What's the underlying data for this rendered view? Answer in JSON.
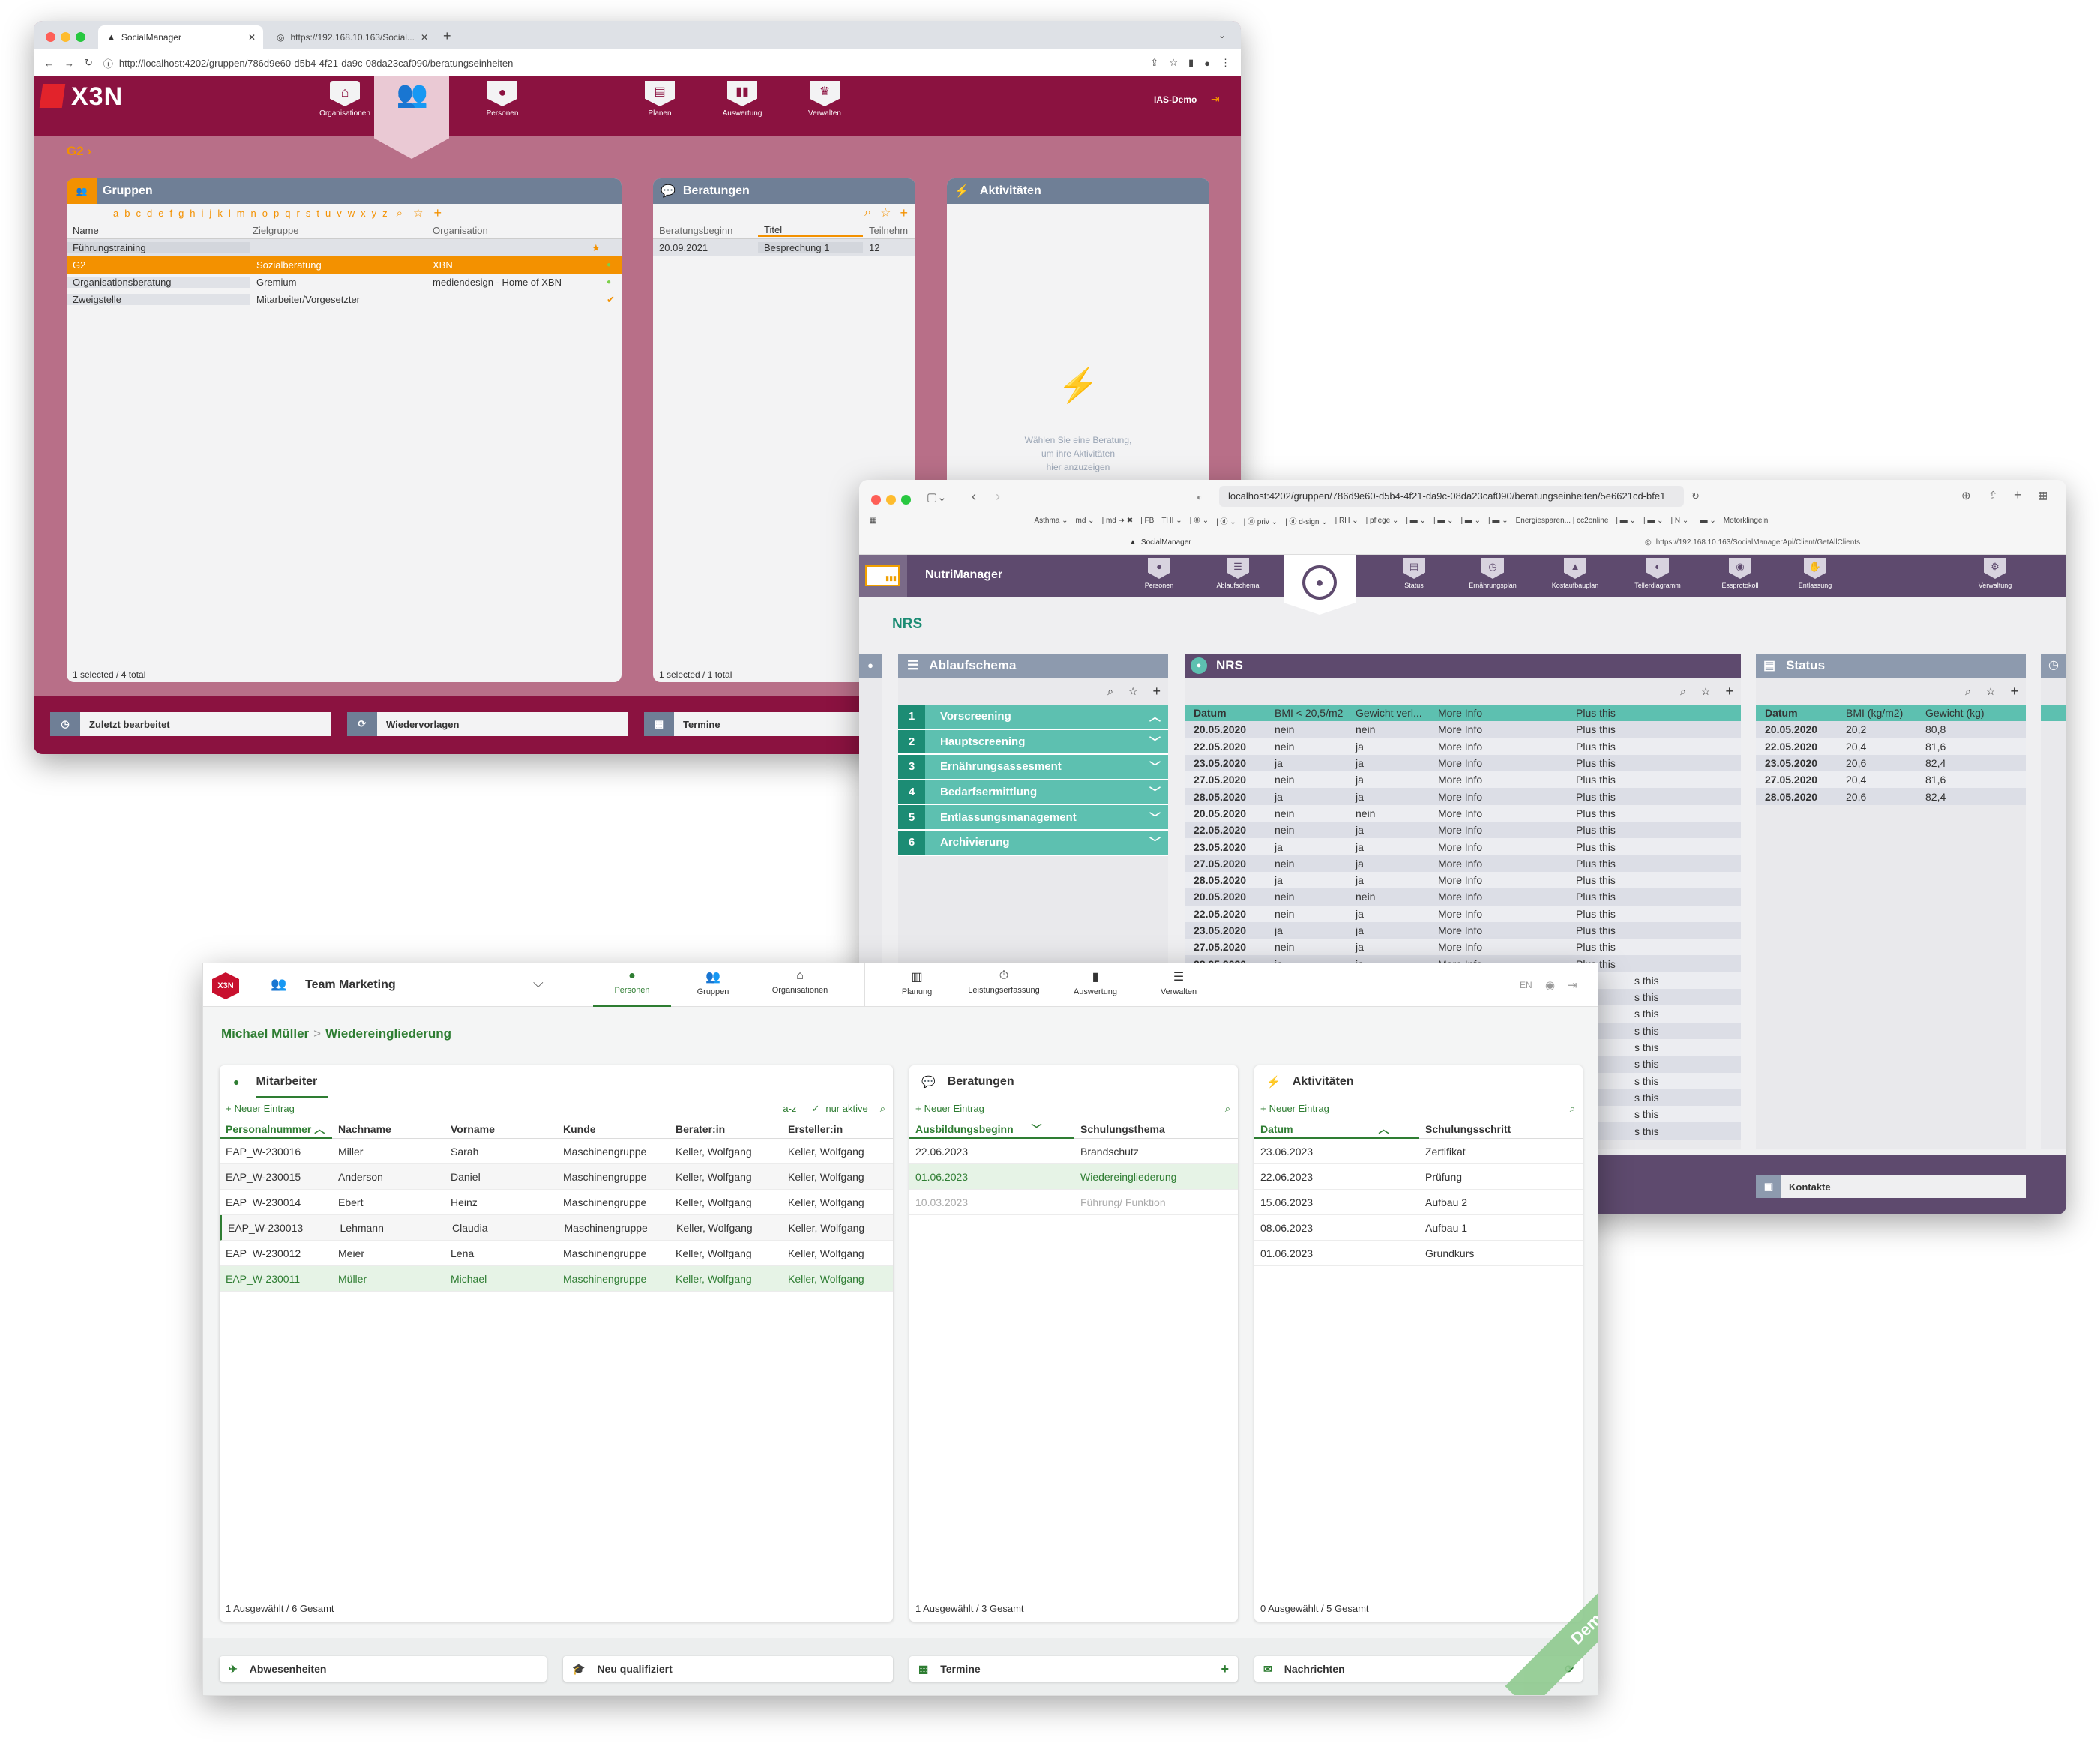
{
  "w1": {
    "tab1": "SocialManager",
    "tab2": "https://192.168.10.163/Social...",
    "url": "http://localhost:4202/gruppen/786d9e60-d5b4-4f21-da9c-08da23caf090/beratungseinheiten",
    "logo": "X3N",
    "nav": [
      "Organisationen",
      "Gruppen",
      "Personen",
      "Planen",
      "Auswertung",
      "Verwalten"
    ],
    "user": "IAS-Demo",
    "breadcrumb": "G2 ›",
    "gruppen": {
      "title": "Gruppen",
      "alphabet": [
        "a",
        "b",
        "c",
        "d",
        "e",
        "f",
        "g",
        "h",
        "i",
        "j",
        "k",
        "l",
        "m",
        "n",
        "o",
        "p",
        "q",
        "r",
        "s",
        "t",
        "u",
        "v",
        "w",
        "x",
        "y",
        "z"
      ],
      "columns": [
        "Name",
        "Zielgruppe",
        "Organisation"
      ],
      "rows": [
        {
          "name": "Führungstraining",
          "ziel": "",
          "org": ""
        },
        {
          "name": "G2",
          "ziel": "Sozialberatung",
          "org": "XBN"
        },
        {
          "name": "Organisationsberatung",
          "ziel": "Gremium",
          "org": "mediendesign - Home of XBN"
        },
        {
          "name": "Zweigstelle",
          "ziel": "Mitarbeiter/Vorgesetzter",
          "org": ""
        }
      ],
      "footer": "1 selected / 4 total"
    },
    "beratungen": {
      "title": "Beratungen",
      "columns": [
        "Beratungsbeginn",
        "Titel",
        "Teilnehm"
      ],
      "rows": [
        {
          "beginn": "20.09.2021",
          "titel": "Besprechung 1",
          "teil": "12"
        }
      ],
      "footer": "1 selected / 1 total"
    },
    "aktivitaeten": {
      "title": "Aktivitäten",
      "empty": [
        "Wählen Sie eine Beratung,",
        "um ihre Aktivitäten",
        "hier anzuzeigen"
      ]
    },
    "bottom": [
      "Zuletzt bearbeitet",
      "Wiedervorlagen",
      "Termine"
    ]
  },
  "w2": {
    "url": "localhost:4202/gruppen/786d9e60-d5b4-4f21-da9c-08da23caf090/beratungseinheiten/5e6621cd-bfe1",
    "bookmarks": [
      "Asthma ⌄",
      "md ⌄",
      "| md ➔ ✖",
      "| FB",
      "THI ⌄",
      "| ⑧ ⌄",
      "| ⓓ ⌄",
      "| ⓓ priv ⌄",
      "| ⓓ d-sign ⌄",
      "| RH ⌄",
      "| pflege ⌄",
      "| ▬ ⌄",
      "| ▬ ⌄",
      "| ▬ ⌄",
      "| ▬ ⌄",
      "Energiesparen... | cc2online",
      "| ▬ ⌄",
      "| ▬ ⌄",
      "| N ⌄",
      "| ▬ ⌄",
      "Motorklingeln"
    ],
    "tab1": "SocialManager",
    "tab2": "https://192.168.10.163/SocialManagerApi/Client/GetAllClients",
    "appname": "NutriManager",
    "nav": [
      "Personen",
      "Ablaufschema",
      "",
      "Status",
      "Ernährungsplan",
      "Kostaufbauplan",
      "Tellerdiagramm",
      "Essprotokoll",
      "Entlassung",
      "Verwaltung"
    ],
    "page_title": "NRS",
    "ablauf": {
      "title": "Ablaufschema",
      "steps": [
        {
          "n": "1",
          "label": "Vorscreening"
        },
        {
          "n": "2",
          "label": "Hauptscreening"
        },
        {
          "n": "3",
          "label": "Ernährungsassesment"
        },
        {
          "n": "4",
          "label": "Bedarfsermittlung"
        },
        {
          "n": "5",
          "label": "Entlassungsmanagement"
        },
        {
          "n": "6",
          "label": "Archivierung"
        }
      ]
    },
    "nrs": {
      "title": "NRS",
      "columns": [
        "Datum",
        "BMI < 20,5/m2",
        "Gewicht verl...",
        "More Info",
        "Plus this"
      ],
      "rows": [
        [
          "20.05.2020",
          "nein",
          "nein",
          "More Info",
          "Plus this"
        ],
        [
          "22.05.2020",
          "nein",
          "ja",
          "More Info",
          "Plus this"
        ],
        [
          "23.05.2020",
          "ja",
          "ja",
          "More Info",
          "Plus this"
        ],
        [
          "27.05.2020",
          "nein",
          "ja",
          "More Info",
          "Plus this"
        ],
        [
          "28.05.2020",
          "ja",
          "ja",
          "More Info",
          "Plus this"
        ],
        [
          "20.05.2020",
          "nein",
          "nein",
          "More Info",
          "Plus this"
        ],
        [
          "22.05.2020",
          "nein",
          "ja",
          "More Info",
          "Plus this"
        ],
        [
          "23.05.2020",
          "ja",
          "ja",
          "More Info",
          "Plus this"
        ],
        [
          "27.05.2020",
          "nein",
          "ja",
          "More Info",
          "Plus this"
        ],
        [
          "28.05.2020",
          "ja",
          "ja",
          "More Info",
          "Plus this"
        ],
        [
          "20.05.2020",
          "nein",
          "nein",
          "More Info",
          "Plus this"
        ],
        [
          "22.05.2020",
          "nein",
          "ja",
          "More Info",
          "Plus this"
        ],
        [
          "23.05.2020",
          "ja",
          "ja",
          "More Info",
          "Plus this"
        ],
        [
          "27.05.2020",
          "nein",
          "ja",
          "More Info",
          "Plus this"
        ],
        [
          "28.05.2020",
          "ja",
          "ja",
          "More Info",
          "Plus this"
        ]
      ],
      "tail": [
        "s this",
        "s this",
        "s this",
        "s this",
        "s this",
        "s this",
        "s this",
        "s this",
        "s this",
        "s this"
      ]
    },
    "status": {
      "title": "Status",
      "columns": [
        "Datum",
        "BMI (kg/m2)",
        "Gewicht (kg)"
      ],
      "rows": [
        [
          "20.05.2020",
          "20,2",
          "80,8"
        ],
        [
          "22.05.2020",
          "20,4",
          "81,6"
        ],
        [
          "23.05.2020",
          "20,6",
          "82,4"
        ],
        [
          "27.05.2020",
          "20,4",
          "81,6"
        ],
        [
          "28.05.2020",
          "20,6",
          "82,4"
        ]
      ]
    },
    "bottom": "Kontakte"
  },
  "w3": {
    "logo": "X3N",
    "team": "Team Marketing",
    "nav_left": [
      "Personen",
      "Gruppen",
      "Organisationen"
    ],
    "nav_right": [
      "Planung",
      "Leistungserfassung",
      "Auswertung",
      "Verwalten"
    ],
    "lang": "EN",
    "breadcrumb_name": "Michael Müller",
    "breadcrumb_sep": ">",
    "breadcrumb_page": "Wiedereingliederung",
    "mitarbeiter": {
      "tab": "Mitarbeiter",
      "new": "Neuer Eintrag",
      "sort": "a-z",
      "filter": "nur aktive",
      "columns": [
        "Personalnummer",
        "Nachname",
        "Vorname",
        "Kunde",
        "Berater:in",
        "Ersteller:in"
      ],
      "rows": [
        [
          "EAP_W-230016",
          "Miller",
          "Sarah",
          "Maschinengruppe",
          "Keller, Wolfgang",
          "Keller, Wolfgang"
        ],
        [
          "EAP_W-230015",
          "Anderson",
          "Daniel",
          "Maschinengruppe",
          "Keller, Wolfgang",
          "Keller, Wolfgang"
        ],
        [
          "EAP_W-230014",
          "Ebert",
          "Heinz",
          "Maschinengruppe",
          "Keller, Wolfgang",
          "Keller, Wolfgang"
        ],
        [
          "EAP_W-230013",
          "Lehmann",
          "Claudia",
          "Maschinengruppe",
          "Keller, Wolfgang",
          "Keller, Wolfgang"
        ],
        [
          "EAP_W-230012",
          "Meier",
          "Lena",
          "Maschinengruppe",
          "Keller, Wolfgang",
          "Keller, Wolfgang"
        ],
        [
          "EAP_W-230011",
          "Müller",
          "Michael",
          "Maschinengruppe",
          "Keller, Wolfgang",
          "Keller, Wolfgang"
        ]
      ],
      "footer": "1 Ausgewählt / 6 Gesamt"
    },
    "beratungen": {
      "title": "Beratungen",
      "new": "Neuer Eintrag",
      "columns": [
        "Ausbildungsbeginn",
        "Schulungsthema"
      ],
      "rows": [
        [
          "22.06.2023",
          "Brandschutz"
        ],
        [
          "01.06.2023",
          "Wiedereingliederung"
        ],
        [
          "10.03.2023",
          "Führung/ Funktion"
        ]
      ],
      "footer": "1 Ausgewählt / 3 Gesamt"
    },
    "aktivitaeten": {
      "title": "Aktivitäten",
      "new": "Neuer Eintrag",
      "columns": [
        "Datum",
        "Schulungsschritt"
      ],
      "rows": [
        [
          "23.06.2023",
          "Zertifikat"
        ],
        [
          "22.06.2023",
          "Prüfung"
        ],
        [
          "15.06.2023",
          "Aufbau 2"
        ],
        [
          "08.06.2023",
          "Aufbau 1"
        ],
        [
          "01.06.2023",
          "Grundkurs"
        ]
      ],
      "footer": "0 Ausgewählt / 5 Gesamt"
    },
    "bottom": [
      "Abwesenheiten",
      "Neu qualifiziert",
      "Termine",
      "Nachrichten"
    ],
    "ribbon": "Demo-System"
  },
  "colors": {
    "w1_bg": "#b86f88",
    "w1_bar": "#8b1240",
    "w1_accent": "#f39100",
    "w2_bar": "#5e4a6e",
    "w2_teal": "#5dc0b0",
    "w3_green": "#2e7d32"
  }
}
